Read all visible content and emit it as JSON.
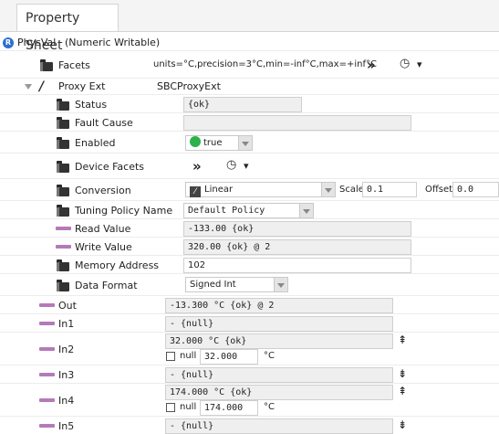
{
  "tab": {
    "label": "Property Sheet"
  },
  "root": {
    "badge": "R",
    "name": "PhysVal",
    "type": "(Numeric Writable)"
  },
  "facets": {
    "label": "Facets",
    "value": "units=°C,precision=3°C,min=-inf°C,max=+inf°C",
    "chevron": "»",
    "clock": "◷",
    "caret": "▾"
  },
  "proxy_ext": {
    "label": "Proxy Ext",
    "value": "SBCProxyExt"
  },
  "status": {
    "label": "Status",
    "value": "{ok}"
  },
  "fault_cause": {
    "label": "Fault Cause",
    "value": ""
  },
  "enabled": {
    "label": "Enabled",
    "value": "true"
  },
  "device_facets": {
    "label": "Device Facets",
    "chevron": "»",
    "clock": "◷",
    "caret": "▾"
  },
  "conversion": {
    "label": "Conversion",
    "value": "Linear",
    "scale_label": "Scale",
    "scale_value": "0.1",
    "offset_label": "Offset",
    "offset_value": "0.0"
  },
  "tuning": {
    "label": "Tuning Policy Name",
    "value": "Default Policy"
  },
  "read_value": {
    "label": "Read Value",
    "value": "-133.00 {ok}"
  },
  "write_value": {
    "label": "Write Value",
    "value": "320.00 {ok} @ 2"
  },
  "memory_address": {
    "label": "Memory Address",
    "value": "102"
  },
  "data_format": {
    "label": "Data Format",
    "value": "Signed Int"
  },
  "out": {
    "label": "Out",
    "value": "-13.300 °C {ok} @ 2"
  },
  "in1": {
    "label": "In1",
    "value": "- {null}",
    "arrow": ""
  },
  "in2": {
    "label": "In2",
    "value": "32.000 °C {ok}",
    "null_label": "null",
    "input": "32.000",
    "unit": "°C",
    "arrow": "⇞"
  },
  "in3": {
    "label": "In3",
    "value": "- {null}",
    "arrow": "⇟"
  },
  "in4": {
    "label": "In4",
    "value": "174.000 °C {ok}",
    "null_label": "null",
    "input": "174.000",
    "unit": "°C",
    "arrow": "⇞"
  },
  "in5": {
    "label": "In5",
    "value": "- {null}",
    "arrow": "⇟"
  }
}
